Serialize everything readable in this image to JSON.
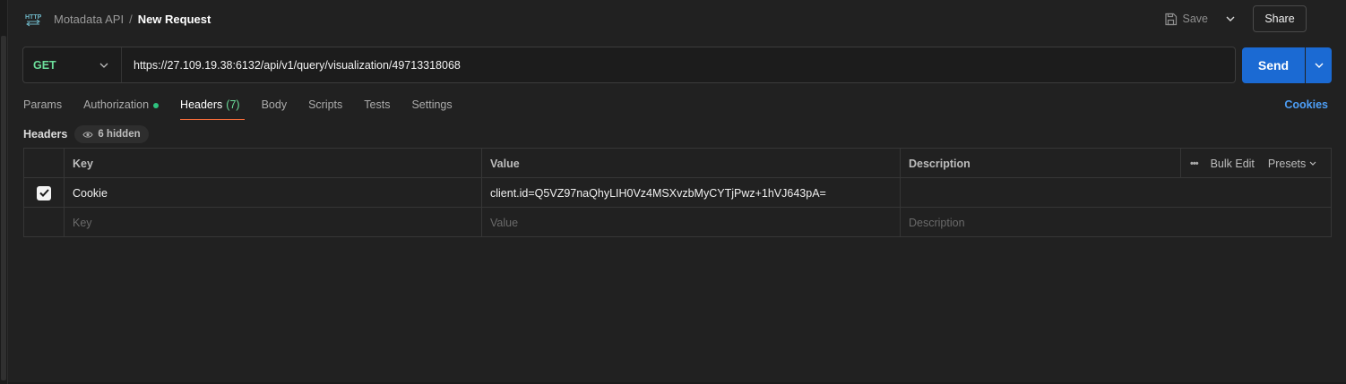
{
  "breadcrumb": {
    "parent": "Motadata API",
    "separator": "/",
    "current": "New Request"
  },
  "toolbar": {
    "save_label": "Save",
    "share_label": "Share"
  },
  "request": {
    "method": "GET",
    "url": "https://27.109.19.38:6132/api/v1/query/visualization/49713318068",
    "send_label": "Send"
  },
  "tabs": [
    {
      "label": "Params"
    },
    {
      "label": "Authorization"
    },
    {
      "label": "Headers",
      "count": "(7)"
    },
    {
      "label": "Body"
    },
    {
      "label": "Scripts"
    },
    {
      "label": "Tests"
    },
    {
      "label": "Settings"
    }
  ],
  "active_tab": "Headers",
  "cookies_label": "Cookies",
  "headers_section": {
    "title": "Headers",
    "hidden_label": "6 hidden"
  },
  "table": {
    "columns": {
      "key": "Key",
      "value": "Value",
      "description": "Description"
    },
    "actions": {
      "bulk_edit": "Bulk Edit",
      "presets": "Presets"
    },
    "rows": [
      {
        "checked": true,
        "key": "Cookie",
        "value": "client.id=Q5VZ97naQhyLIH0Vz4MSXvzbMyCYTjPwz+1hVJ643pA=",
        "description": ""
      }
    ],
    "placeholders": {
      "key": "Key",
      "value": "Value",
      "description": "Description"
    }
  },
  "colors": {
    "accent_send": "#1b6ad3",
    "method_get": "#6bdd9a",
    "active_tab_underline": "#f26b3a",
    "cookies_link": "#4d9ef6"
  }
}
